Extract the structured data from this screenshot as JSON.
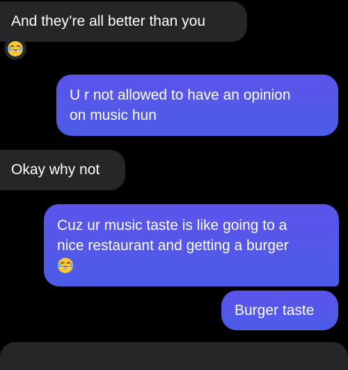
{
  "messages": [
    {
      "id": "m1",
      "direction": "incoming",
      "lines": [
        "And they’re all better than you"
      ],
      "reaction_icon": "face-with-tears-of-joy-icon"
    },
    {
      "id": "m2",
      "direction": "outgoing",
      "lines": [
        "U r not allowed to have an opinion",
        "on music hun"
      ]
    },
    {
      "id": "m3",
      "direction": "incoming",
      "lines": [
        "Okay why not"
      ]
    },
    {
      "id": "m4",
      "direction": "outgoing",
      "lines": [
        "Cuz ur music taste is like going to a",
        "nice restaurant and getting a burger"
      ],
      "trailing_icon": "face-with-tears-of-joy-icon"
    },
    {
      "id": "m5",
      "direction": "outgoing",
      "lines": [
        "Burger taste"
      ]
    }
  ],
  "colors": {
    "background": "#000000",
    "incoming_bubble": "#262628",
    "outgoing_bubble": "#5558ea",
    "text": "#ffffff"
  }
}
